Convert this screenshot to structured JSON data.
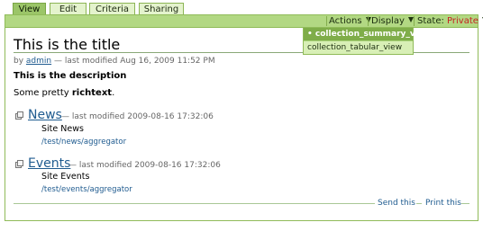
{
  "tabs": [
    {
      "label": "View",
      "selected": true
    },
    {
      "label": "Edit",
      "selected": false
    },
    {
      "label": "Criteria",
      "selected": false
    },
    {
      "label": "Sharing",
      "selected": false
    }
  ],
  "contentbar": {
    "actions_label": "Actions",
    "display_label": "Display",
    "state_label": "State:",
    "state_value": "Private"
  },
  "display_menu": {
    "items": [
      {
        "label": "collection_summary_view",
        "selected": true
      },
      {
        "label": "collection_tabular_view",
        "selected": false
      }
    ]
  },
  "document": {
    "title": "This is the title",
    "byline_prefix": "by",
    "author": "admin",
    "byline_modified": "— last modified Aug 16, 2009 11:52 PM",
    "description": "This is the description",
    "body_prefix": "Some pretty ",
    "body_bold": "richtext",
    "body_suffix": "."
  },
  "listing": [
    {
      "title": "News",
      "modified": "— last modified 2009-08-16 17:32:06",
      "description": "Site News",
      "url": "/test/news/aggregator"
    },
    {
      "title": "Events",
      "modified": "— last modified 2009-08-16 17:32:06",
      "description": "Site Events",
      "url": "/test/events/aggregator"
    }
  ],
  "footer": {
    "send_label": "Send this",
    "print_label": "Print this"
  },
  "colors": {
    "accent": "#b2d883",
    "border": "#90bb59",
    "link": "#205c90",
    "state_private": "#c62323"
  }
}
